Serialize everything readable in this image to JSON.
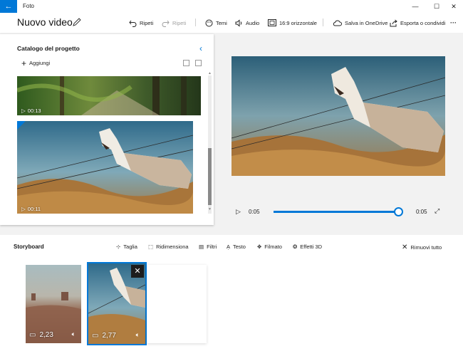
{
  "titlebar": {
    "back_glyph": "←",
    "app_name": "Foto",
    "minimize": "—",
    "maximize": "☐",
    "close": "✕"
  },
  "command_bar": {
    "project_title": "Nuovo video",
    "undo": "Ripeti",
    "redo": "Ripeti",
    "themes": "Temi",
    "audio": "Audio",
    "aspect": "16:9 orizzontale",
    "save_onedrive": "Salva in OneDrive",
    "export": "Esporta o condividi",
    "more": "···"
  },
  "library": {
    "title": "Catalogo del progetto",
    "add_label": "Aggiungi",
    "items": [
      {
        "duration": "00:13"
      },
      {
        "duration": "00:11"
      }
    ]
  },
  "player": {
    "current_time": "0:05",
    "total_time": "0:05",
    "progress": 1.0
  },
  "storyboard": {
    "title": "Storyboard",
    "tools": {
      "trim": "Taglia",
      "resize": "Ridimensiona",
      "filters": "Filtri",
      "text": "Testo",
      "motion": "Filmato",
      "effects3d": "Effetti 3D",
      "remove_all": "Rimuovi tutto"
    },
    "clips": [
      {
        "duration": "2,23"
      },
      {
        "duration": "2,77"
      }
    ]
  },
  "colors": {
    "accent": "#0078d7"
  }
}
